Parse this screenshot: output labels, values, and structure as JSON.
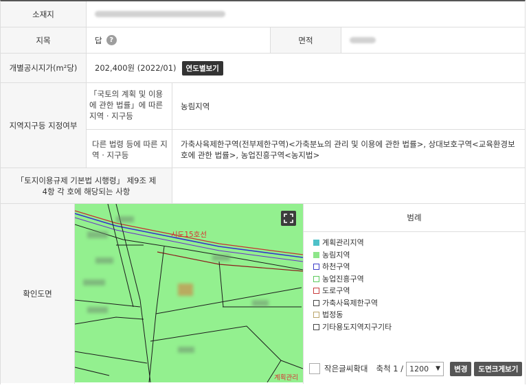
{
  "rows": {
    "address_label": "소재지",
    "jimok_label": "지목",
    "jimok_value": "답",
    "area_label": "면적",
    "price_label": "개별공시지가(m²당)",
    "price_value": "202,400원 (2022/01)",
    "price_button": "연도별보기",
    "zone_label": "지역지구등 지정여부",
    "zone_sub1_label": "「국토의 계획 및 이용에 관한 법률」에 따른 지역 · 지구등",
    "zone_sub1_value": "농림지역",
    "zone_sub2_label": "다른 법령 등에 따른 지역 · 지구등",
    "zone_sub2_value": "가축사육제한구역(전부제한구역)<가축분뇨의 관리 및 이용에 관한 법률>, 상대보호구역<교육환경보호에 관한 법률>, 농업진흥구역<농지법>",
    "regulation_label": "「토지이용규제 기본법 시행령」 제9조 제4항 각 호에 해당되는 사항",
    "map_label": "확인도면"
  },
  "map": {
    "road_label": "시도15호선",
    "corner_label": "계획관리"
  },
  "legend": {
    "title": "범례",
    "items": [
      {
        "label": "계획관리지역",
        "color": "#4fc1c9",
        "style": "fill"
      },
      {
        "label": "농림지역",
        "color": "#8ee68a",
        "style": "fill"
      },
      {
        "label": "하천구역",
        "color": "#3b3bc8",
        "style": "outline"
      },
      {
        "label": "농업진흥구역",
        "color": "#5cc95c",
        "style": "outline"
      },
      {
        "label": "도로구역",
        "color": "#c83b3b",
        "style": "outline"
      },
      {
        "label": "가축사육제한구역",
        "color": "#444444",
        "style": "outline"
      },
      {
        "label": "법정동",
        "color": "#b9a46a",
        "style": "outline"
      },
      {
        "label": "기타용도지역지구기타",
        "color": "#444444",
        "style": "outline"
      }
    ]
  },
  "controls": {
    "enlarge_text_label": "작은글씨확대",
    "scale_label": "축척 1 /",
    "scale_value": "1200",
    "change_button": "변경",
    "bigmap_button": "도면크게보기"
  }
}
